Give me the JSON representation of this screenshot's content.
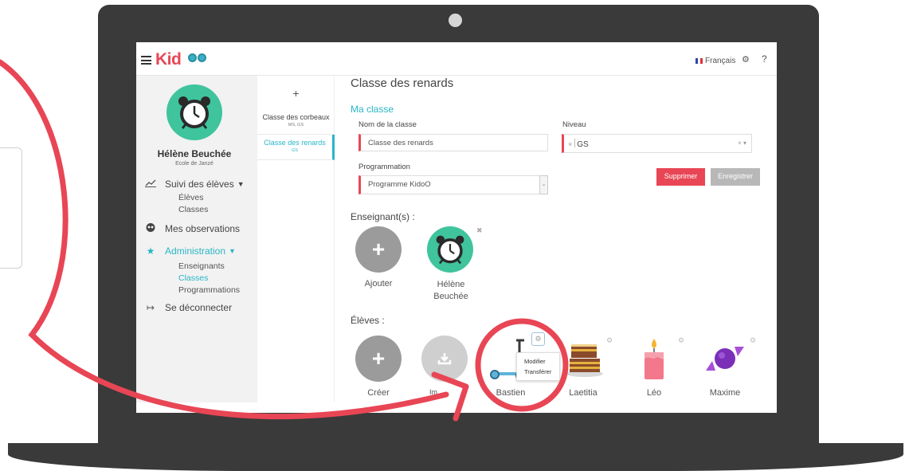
{
  "app": {
    "logo_text": "Kid",
    "language": "Français",
    "help": "?"
  },
  "sidebar": {
    "user_name": "Hélène Beuchée",
    "school": "Ecole de Janzé",
    "nav": [
      {
        "label": "Suivi des élèves",
        "icon": "chart-line-icon"
      },
      {
        "label": "Mes observations",
        "icon": "owl-icon"
      },
      {
        "label": "Administration",
        "icon": "star-icon"
      },
      {
        "label": "Se déconnecter",
        "icon": "logout-icon"
      }
    ],
    "suivi_sub": [
      "Élèves",
      "Classes"
    ],
    "admin_sub": [
      "Enseignants",
      "Classes",
      "Programmations"
    ]
  },
  "classes": {
    "add": "+",
    "items": [
      {
        "name": "Classe des corbeaux",
        "levels": "MS, GS"
      },
      {
        "name": "Classe des renards",
        "levels": "GS"
      }
    ]
  },
  "main": {
    "title": "Classe des renards",
    "section": "Ma classe",
    "name_label": "Nom de la classe",
    "name_value": "Classe des renards",
    "level_label": "Niveau",
    "level_value": "GS",
    "level_remove": "×",
    "level_controls": "× ▾",
    "program_label": "Programmation",
    "program_value": "Programme KidoO",
    "delete_label": "Supprimer",
    "save_label": "Enregistrer",
    "teachers_label": "Enseignant(s) :",
    "add_teacher": "Ajouter",
    "teacher_name": "Hélène Beuchée",
    "students_label": "Élèves :",
    "create_student": "Créer",
    "import_student": "Im",
    "students": [
      "Bastien",
      "Laetitia",
      "Léo",
      "Maxime"
    ],
    "menu": [
      "Modifier",
      "Transférer"
    ]
  },
  "colors": {
    "brand_red": "#e84655",
    "teal": "#2ab5c6",
    "green": "#3fc49d",
    "annotation": "#e84655",
    "laptop": "#3a3a3a"
  }
}
